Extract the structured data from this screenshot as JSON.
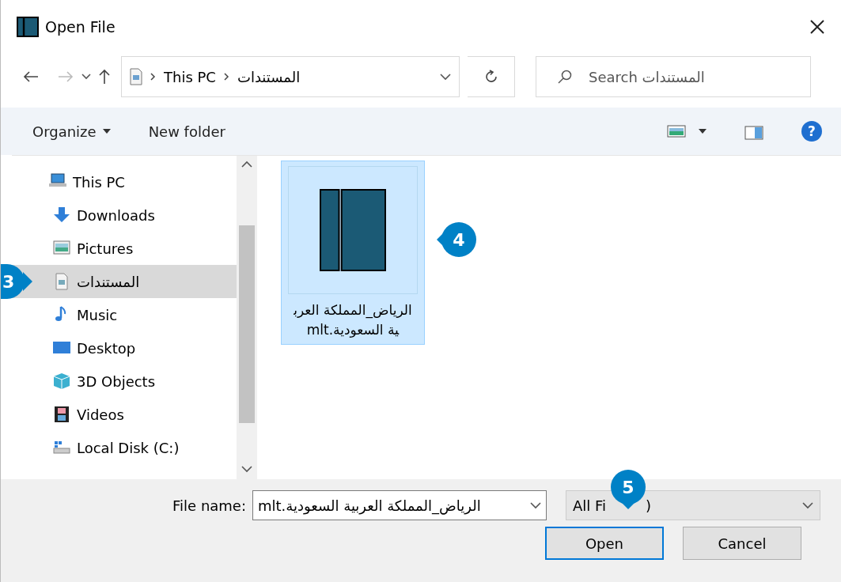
{
  "window": {
    "title": "Open File"
  },
  "address": {
    "segments": [
      "This PC",
      "المستندات"
    ]
  },
  "search": {
    "placeholder": "Search المستندات"
  },
  "toolbar": {
    "organize": "Organize",
    "new_folder": "New folder",
    "help": "?"
  },
  "sidebar": {
    "items": [
      {
        "label": "This PC",
        "selected": false,
        "children": [
          {
            "label": "Downloads",
            "selected": false
          },
          {
            "label": "Pictures",
            "selected": false
          },
          {
            "label": "المستندات",
            "selected": true
          },
          {
            "label": "Music",
            "selected": false
          },
          {
            "label": "Desktop",
            "selected": false
          },
          {
            "label": "3D Objects",
            "selected": false
          },
          {
            "label": "Videos",
            "selected": false
          },
          {
            "label": "Local Disk (C:)",
            "selected": false
          }
        ]
      }
    ]
  },
  "files": [
    {
      "name": "الرياض_المملكة العربية السعودية.mlt",
      "selected": true
    }
  ],
  "footer": {
    "file_name_label": "File name:",
    "file_name_value": "الرياض_المملكة العربية السعودية.mlt",
    "filter_parts": [
      "All Fi",
      ")"
    ],
    "open": "Open",
    "cancel": "Cancel"
  },
  "callouts": [
    {
      "number": "3"
    },
    {
      "number": "4"
    },
    {
      "number": "5"
    }
  ]
}
